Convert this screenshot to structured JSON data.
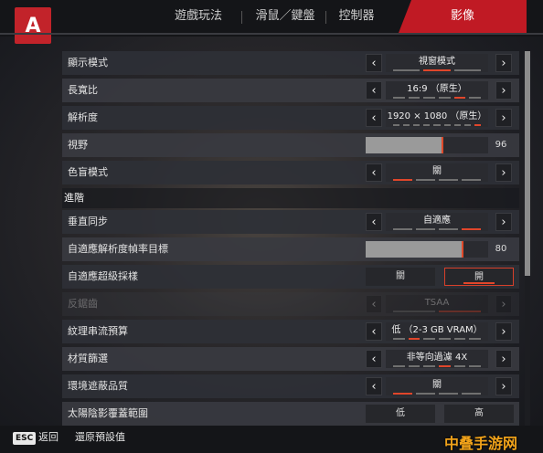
{
  "tabs": [
    {
      "label": "遊戲玩法",
      "active": false
    },
    {
      "label": "滑鼠／鍵盤",
      "active": false
    },
    {
      "label": "控制器",
      "active": false
    },
    {
      "label": "影像",
      "active": true
    }
  ],
  "logo": {
    "glyph": "A",
    "icon": "apex-logo-icon",
    "color": "#c2232a"
  },
  "settings": {
    "display_mode": {
      "label": "顯示模式",
      "value": "視窗模式",
      "dots": [
        false,
        true,
        false
      ]
    },
    "aspect_ratio": {
      "label": "長寬比",
      "value": "16:9 （原生）",
      "dots": [
        false,
        false,
        false,
        false,
        true,
        false
      ]
    },
    "resolution": {
      "label": "解析度",
      "value": "1920 × 1080 （原生）",
      "dots": [
        false,
        false,
        false,
        false,
        false,
        false,
        false,
        false,
        true
      ]
    },
    "fov": {
      "label": "視野",
      "value": "96",
      "fill_fraction": 0.62
    },
    "colorblind": {
      "label": "色盲模式",
      "value": "關",
      "dots": [
        true,
        false,
        false,
        false
      ]
    },
    "advanced_header": "進階",
    "vsync": {
      "label": "垂直同步",
      "value": "自適應",
      "dots": [
        false,
        false,
        false,
        true
      ]
    },
    "adaptive_fps": {
      "label": "自適應解析度幀率目標",
      "value": "80",
      "fill_fraction": 0.78
    },
    "adaptive_ss": {
      "label": "自適應超級採樣",
      "off": "關",
      "on": "開",
      "selected": "on"
    },
    "aa": {
      "label": "反鋸齒",
      "value": "TSAA",
      "dots": [
        false,
        true
      ]
    },
    "texture_budget": {
      "label": "紋理串流預算",
      "value": "低 （2-3 GB VRAM）",
      "dots": [
        false,
        true,
        false,
        false,
        false,
        false
      ]
    },
    "texture_filter": {
      "label": "材質篩選",
      "value": "非等向過濾 4X",
      "dots": [
        false,
        false,
        false,
        true,
        false,
        false
      ]
    },
    "ambient_occlusion": {
      "label": "環境遮蔽品質",
      "value": "關",
      "dots": [
        true,
        false,
        false,
        false
      ]
    },
    "sun_shadow": {
      "label": "太陽陰影覆蓋範圍",
      "low": "低",
      "high": "高"
    }
  },
  "footer": {
    "esc": "ESC",
    "back": "返回",
    "reset": "還原預設值"
  },
  "watermark": "中叠手游网",
  "accent_color": "#e0462b"
}
